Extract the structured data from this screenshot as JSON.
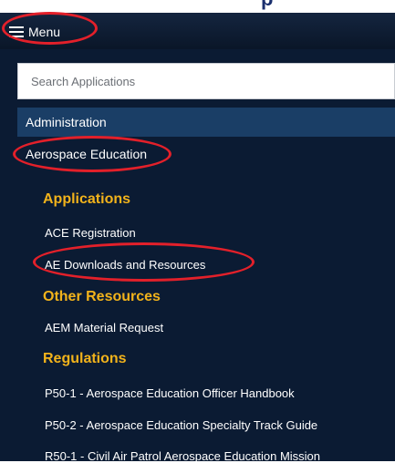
{
  "header": {
    "menu_label": "Menu"
  },
  "search": {
    "placeholder": "Search Applications"
  },
  "nav": {
    "administration": "Administration",
    "aerospace_education": "Aerospace Education"
  },
  "sections": [
    {
      "heading": "Applications",
      "links": [
        "ACE Registration",
        "AE Downloads and Resources"
      ]
    },
    {
      "heading": "Other Resources",
      "links": [
        "AEM Material Request"
      ]
    },
    {
      "heading": "Regulations",
      "links": [
        "P50-1 - Aerospace Education Officer Handbook",
        "P50-2 - Aerospace Education Specialty Track Guide",
        "R50-1 - Civil Air Patrol Aerospace Education Mission"
      ]
    }
  ],
  "colors": {
    "panel": "#0b1b33",
    "accent": "#f2b31b",
    "highlight": "#e3202a",
    "admin_row": "#1a3e66"
  }
}
